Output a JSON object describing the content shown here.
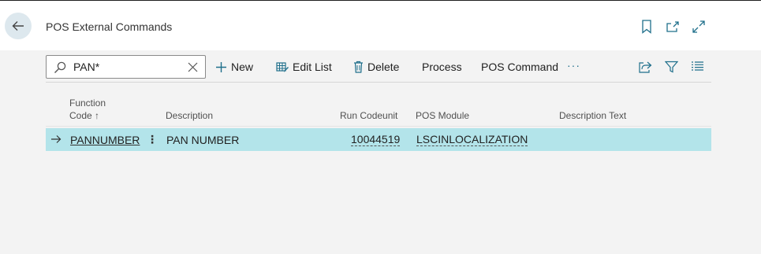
{
  "header": {
    "title": "POS External Commands",
    "icons": [
      "bookmark-icon",
      "open-new-window-icon",
      "expand-icon"
    ]
  },
  "toolbar": {
    "search": {
      "value": "PAN*",
      "placeholder": ""
    },
    "new_label": "New",
    "edit_list_label": "Edit List",
    "delete_label": "Delete",
    "process_label": "Process",
    "pos_command_label": "POS Command",
    "more_label": "···"
  },
  "grid": {
    "columns": {
      "function_code_line1": "Function",
      "function_code_line2": "Code ↑",
      "description": "Description",
      "run_codeunit": "Run Codeunit",
      "pos_module": "POS Module",
      "description_text": "Description Text"
    },
    "rows": [
      {
        "function_code": "PANNUMBER",
        "description": "PAN NUMBER",
        "run_codeunit": "10044519",
        "pos_module": "LSCINLOCALIZATION",
        "description_text": ""
      }
    ]
  },
  "colors": {
    "selected_row": "#b3e4ea",
    "back_button": "#dde8ee",
    "accent": "#1f6f8b"
  }
}
